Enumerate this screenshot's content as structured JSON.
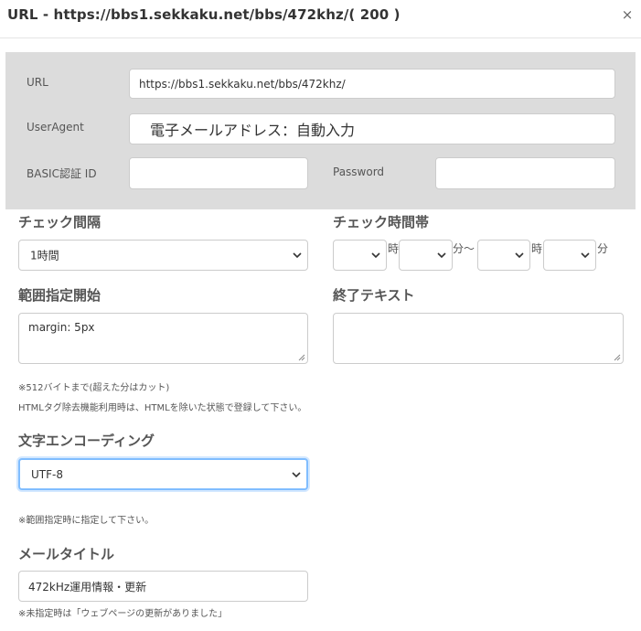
{
  "dialog": {
    "title": "URL - https://bbs1.sekkaku.net/bbs/472khz/( 200 )",
    "close_symbol": "×"
  },
  "fields": {
    "url_label": "URL",
    "url_value": "https://bbs1.sekkaku.net/bbs/472khz/",
    "useragent_label": "UserAgent",
    "useragent_value": "電子メールアドレス：自動入力",
    "basic_id_label": "BASIC認証 ID",
    "basic_id_value": "",
    "password_label": "Password",
    "password_value": ""
  },
  "check_interval": {
    "heading": "チェック間隔",
    "selected": "1時間"
  },
  "check_time": {
    "heading": "チェック時間帯",
    "from_hour": "",
    "from_hour_unit": "時",
    "from_min": "",
    "from_min_unit": "分〜",
    "to_hour": "",
    "to_hour_unit": "時",
    "to_min": "",
    "to_min_unit": "分"
  },
  "range_start": {
    "heading": "範囲指定開始",
    "value": "margin: 5px"
  },
  "end_text": {
    "heading": "終了テキスト",
    "value": ""
  },
  "notes": {
    "byte_limit": "※512バイトまで(超えた分はカット)",
    "html_tag": "HTMLタグ除去機能利用時は、HTMLを除いた状態で登録して下さい。",
    "range_hint": "※範囲指定時に指定して下さい。",
    "mail_title_hint": "※未指定時は「ウェブページの更新がありました」"
  },
  "encoding": {
    "heading": "文字エンコーディング",
    "selected": "UTF-8"
  },
  "mail_title": {
    "heading": "メールタイトル",
    "value": "472kHz運用情報・更新"
  },
  "icons": {
    "close": "close-icon",
    "dropdown": "chevron-down-icon",
    "resize": "resize-handle-icon"
  },
  "colors": {
    "panel_bg": "#dcdcdc",
    "focus_border": "#80bdff"
  }
}
